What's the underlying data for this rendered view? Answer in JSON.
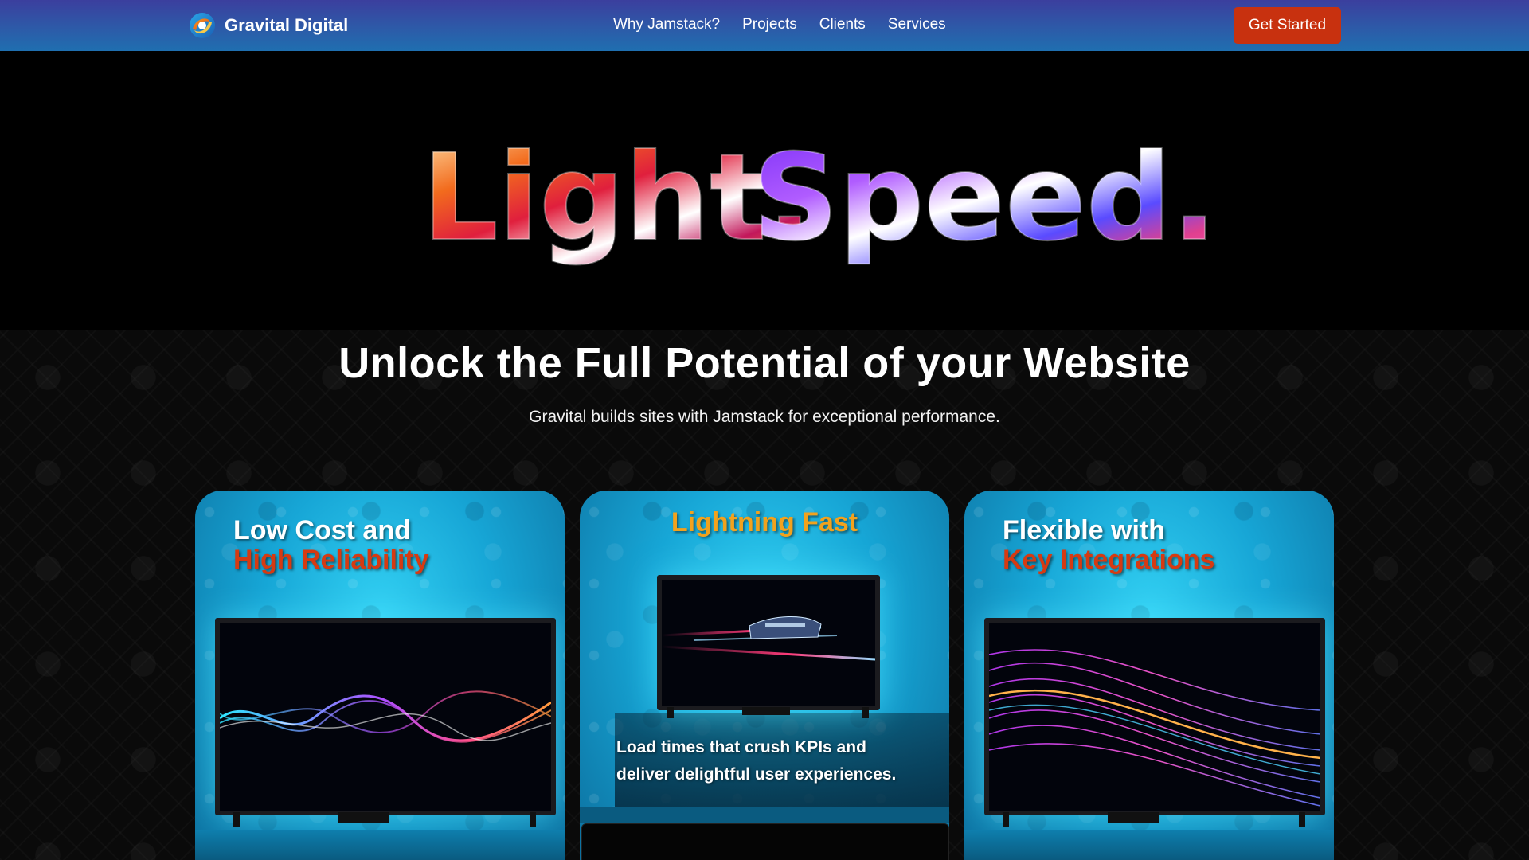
{
  "nav": {
    "brand": "Gravital Digital",
    "links": [
      "Why Jamstack?",
      "Projects",
      "Clients",
      "Services"
    ],
    "cta": "Get Started"
  },
  "hero": {
    "word1": "Light.",
    "word2": "Speed."
  },
  "section": {
    "headline": "Unlock the Full Potential of your Website",
    "subhead": "Gravital builds sites with Jamstack for exceptional performance."
  },
  "cards": [
    {
      "line1": "Low Cost and",
      "line2": "High Reliability"
    },
    {
      "line1": "Lightning Fast",
      "caption": "Load times that crush KPIs and deliver delightful user experiences."
    },
    {
      "line1": "Flexible with",
      "line2": "Key Integrations"
    }
  ],
  "colors": {
    "accent": "#c8310f",
    "nav_top": "#3b3f9e",
    "nav_bottom": "#1f6fb0",
    "card_cyan": "#17a6d6"
  }
}
